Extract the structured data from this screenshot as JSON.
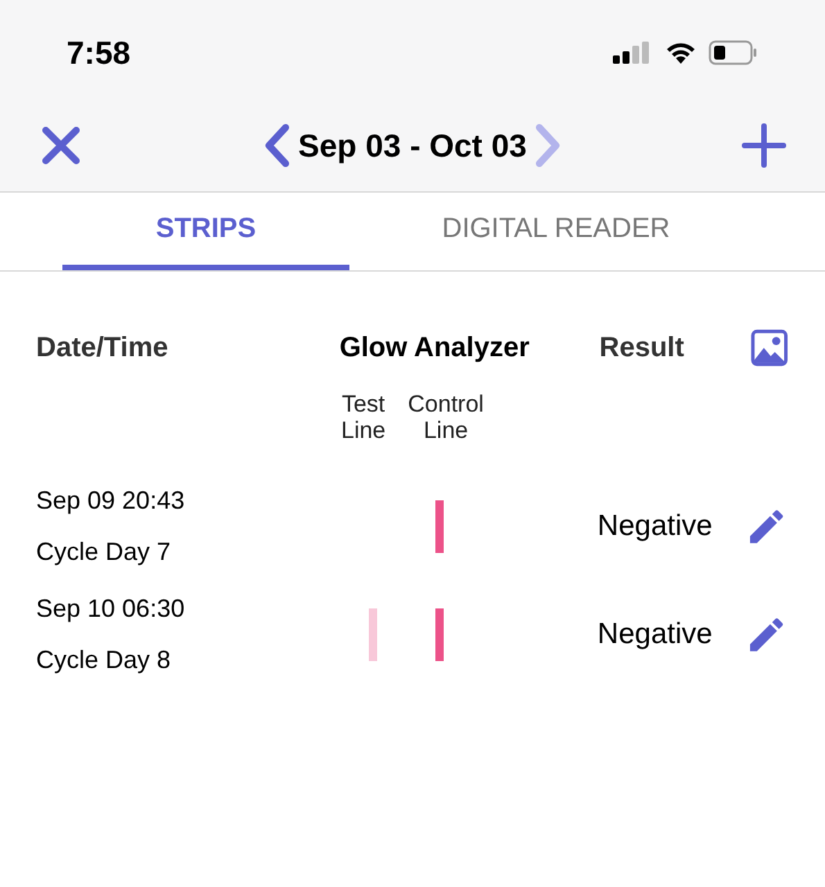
{
  "status_bar": {
    "time": "7:58"
  },
  "nav": {
    "title": "Sep 03 - Oct 03",
    "next_disabled": true
  },
  "tabs": [
    {
      "label": "STRIPS",
      "selected": true
    },
    {
      "label": "DIGITAL READER",
      "selected": false
    }
  ],
  "table": {
    "columns": [
      "Date/Time",
      "Glow Analyzer",
      "Result"
    ],
    "subcolumns": [
      "Test\nLine",
      "Control\nLine"
    ],
    "rows": [
      {
        "date": "Sep 09 20:43",
        "cycle_day": "Cycle Day 7",
        "lines": [
          {
            "kind": "control"
          }
        ],
        "result": "Negative"
      },
      {
        "date": "Sep 10 06:30",
        "cycle_day": "Cycle Day 8",
        "lines": [
          {
            "kind": "test"
          },
          {
            "kind": "control"
          }
        ],
        "result": "Negative"
      }
    ]
  }
}
